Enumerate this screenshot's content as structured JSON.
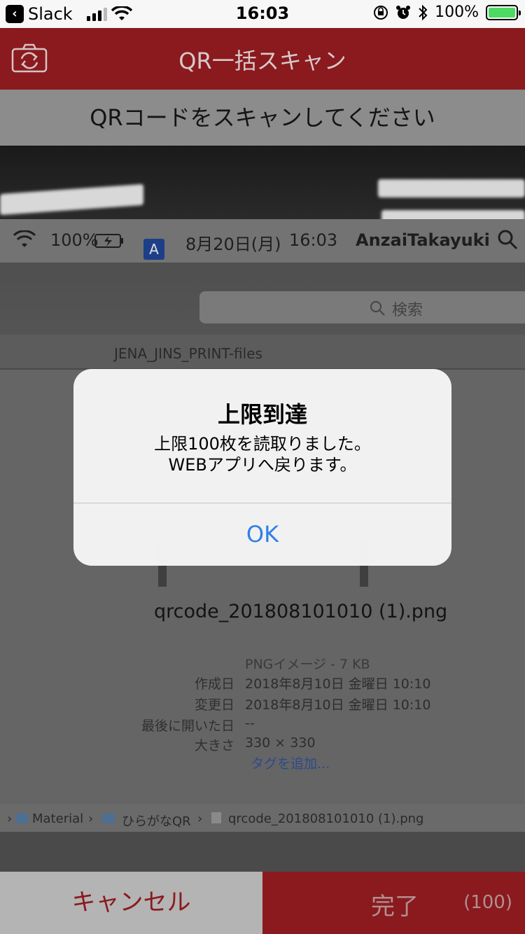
{
  "status_bar": {
    "back_app": "Slack",
    "time": "16:03",
    "battery_percent": "100%",
    "cellular_bars": 3
  },
  "nav": {
    "title": "QR一括スキャン",
    "camera_switch_icon": "camera-switch-icon"
  },
  "instruction": "QRコードをスキャンしてください",
  "camera_view": {
    "menubar": {
      "battery": "100%",
      "input_source": "A",
      "date": "8月20日(月)",
      "time": "16:03",
      "user": "AnzaiTakayuki"
    },
    "search_placeholder": "検索",
    "path_title": "JENA_JINS_PRINT-files",
    "filename": "qrcode_201808101010 (1).png",
    "meta": [
      {
        "key": "",
        "value": "PNGイメージ - 7 KB"
      },
      {
        "key": "作成日",
        "value": "2018年8月10日 金曜日 10:10"
      },
      {
        "key": "変更日",
        "value": "2018年8月10日 金曜日 10:10"
      },
      {
        "key": "最後に開いた日",
        "value": "--"
      },
      {
        "key": "大きさ",
        "value": "330 × 330"
      }
    ],
    "tag_link": "タグを追加...",
    "breadcrumb": [
      "Material",
      "ひらがなQR",
      "qrcode_201808101010 (1).png"
    ]
  },
  "alert": {
    "title": "上限到達",
    "message_line1": "上限100枚を読取りました。",
    "message_line2": "WEBアプリへ戻ります。",
    "ok_label": "OK"
  },
  "bottom": {
    "cancel_label": "キャンセル",
    "done_label": "完了",
    "count": "(100)"
  },
  "colors": {
    "brand_red": "#8a1a1e",
    "alert_button_blue": "#2f80e8",
    "battery_green": "#4cd964"
  }
}
